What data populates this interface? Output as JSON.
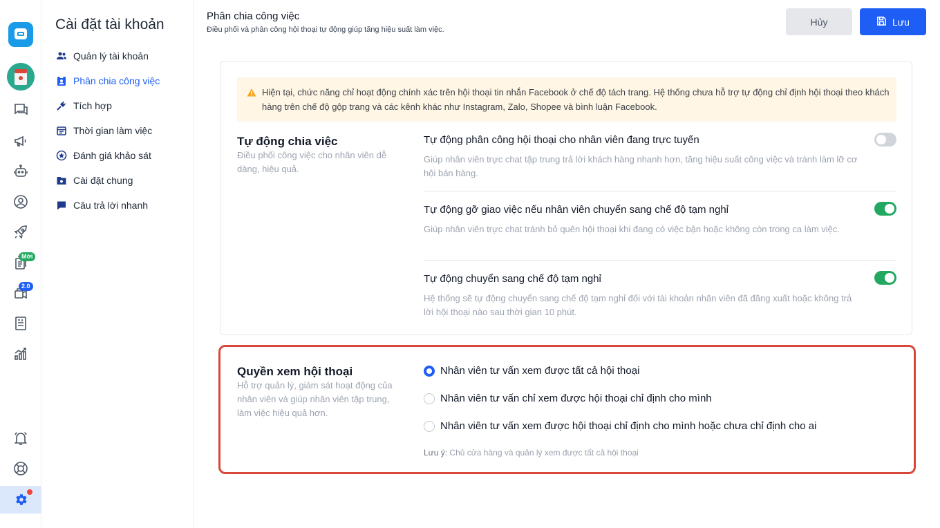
{
  "rail": {
    "badge_new": "Mới",
    "badge_version": "2.0"
  },
  "menu": {
    "title": "Cài đặt tài khoản",
    "items": [
      {
        "label": "Quản lý tài khoản"
      },
      {
        "label": "Phân chia công việc"
      },
      {
        "label": "Tích hợp"
      },
      {
        "label": "Thời gian làm việc"
      },
      {
        "label": "Đánh giá khảo sát"
      },
      {
        "label": "Cài đặt chung"
      },
      {
        "label": "Câu trả lời nhanh"
      }
    ]
  },
  "header": {
    "title": "Phân chia công việc",
    "subtitle": "Điều phối và phân công hội thoại tự động giúp tăng hiệu suất làm việc.",
    "cancel_label": "Hủy",
    "save_label": "Lưu"
  },
  "warning": {
    "text": "Hiện tại, chức năng chỉ hoạt động chính xác trên hội thoại tin nhắn Facebook ở chế độ tách trang. Hệ thống chưa hỗ trợ tự động chỉ định hội thoại theo khách hàng trên chế độ gộp trang và các kênh khác như Instagram, Zalo, Shopee và bình luận Facebook."
  },
  "auto_assign": {
    "title": "Tự động chia việc",
    "desc": "Điều phối công việc cho nhân viên dễ dàng, hiệu quả.",
    "options": [
      {
        "title": "Tự động phân công hội thoại cho nhân viên đang trực tuyến",
        "desc": "Giúp nhân viên trực chat tập trung trả lời khách hàng nhanh hơn, tăng hiệu suất công việc và tránh làm lỡ cơ hội bán hàng.",
        "enabled": false
      },
      {
        "title": "Tự động gỡ giao việc nếu nhân viên chuyển sang chế độ tạm nghỉ",
        "desc": "Giúp nhân viên trực chat tránh bỏ quên hội thoại khi đang có việc bận hoặc không còn trong ca làm việc.",
        "enabled": true
      },
      {
        "title": "Tự động chuyển sang chế độ tạm nghỉ",
        "desc": "Hệ thống sẽ tự động chuyển sang chế độ tạm nghỉ đối với tài khoản nhân viên đã đăng xuất hoặc không trả lời hội thoại nào sau thời gian 10 phút.",
        "enabled": true
      }
    ]
  },
  "view_permission": {
    "title": "Quyền xem hội thoại",
    "desc": "Hỗ trợ quản lý, giám sát hoạt động của nhân viên và giúp nhân viên tập trung, làm việc hiệu quả hơn.",
    "options": [
      {
        "label": "Nhân viên tư vấn xem được tất cả hội thoại",
        "selected": true
      },
      {
        "label": "Nhân viên tư vấn chỉ xem được hội thoại chỉ định cho mình",
        "selected": false
      },
      {
        "label": "Nhân viên tư vấn xem được hội thoại chỉ định cho mình hoặc chưa chỉ định cho ai",
        "selected": false
      }
    ],
    "note_label": "Lưu ý:",
    "note_text": "Chủ cửa hàng và quản lý xem được tất cả hội thoại"
  },
  "colors": {
    "primary": "#1e5ef5",
    "toggle_on": "#22a861",
    "highlight_border": "#d9473b",
    "warning_bg": "#fff6e5"
  }
}
